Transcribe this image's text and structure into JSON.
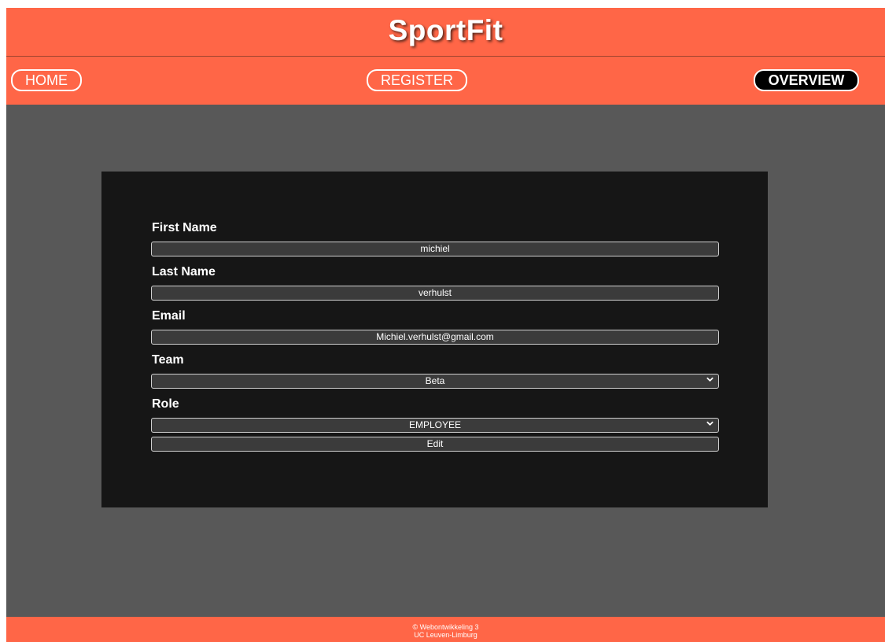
{
  "header": {
    "title": "SportFit"
  },
  "nav": {
    "home_label": "HOME",
    "register_label": "REGISTER",
    "overview_label": "OVERVIEW"
  },
  "form": {
    "first_name": {
      "label": "First Name",
      "value": "michiel"
    },
    "last_name": {
      "label": "Last Name",
      "value": "verhulst"
    },
    "email": {
      "label": "Email",
      "value": "Michiel.verhulst@gmail.com"
    },
    "team": {
      "label": "Team",
      "selected": "Beta"
    },
    "role": {
      "label": "Role",
      "selected": "EMPLOYEE"
    },
    "submit_label": "Edit"
  },
  "footer": {
    "line1": "© Webontwikkeling 3",
    "line2": "UC Leuven-Limburg"
  },
  "colors": {
    "brand": "#ff6647",
    "background": "#585858",
    "card": "#161616",
    "active_nav": "#000000"
  },
  "icons": {
    "select_arrow": "chevron-down-icon"
  }
}
